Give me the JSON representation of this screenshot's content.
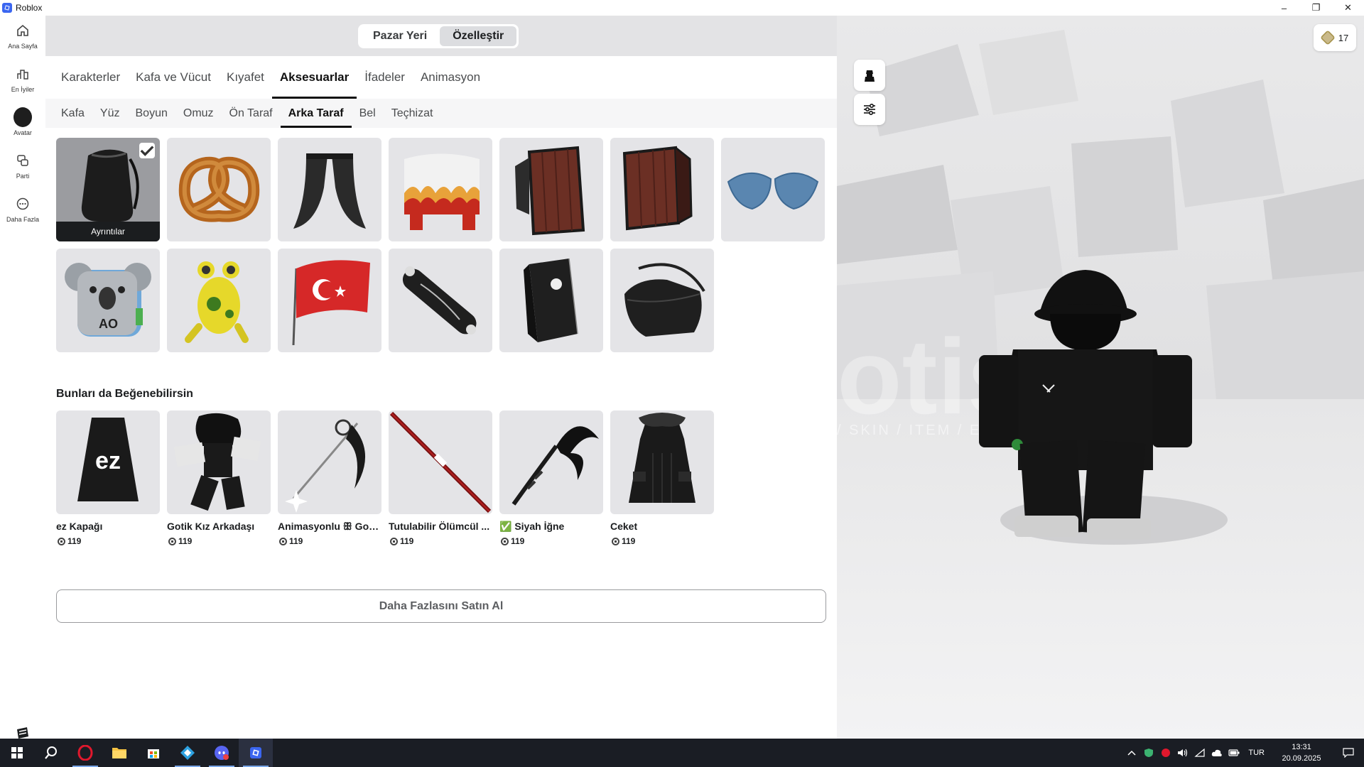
{
  "window": {
    "title": "Roblox"
  },
  "sidebar": [
    {
      "label": "Ana Sayfa"
    },
    {
      "label": "En İyiler"
    },
    {
      "label": "Avatar"
    },
    {
      "label": "Parti"
    },
    {
      "label": "Daha Fazla"
    }
  ],
  "segment": [
    {
      "label": "Pazar Yeri"
    },
    {
      "label": "Özelleştir"
    }
  ],
  "main_tabs": [
    "Karakterler",
    "Kafa ve Vücut",
    "Kıyafet",
    "Aksesuarlar",
    "İfadeler",
    "Animasyon"
  ],
  "main_tab_active": "Aksesuarlar",
  "sub_tabs": [
    "Kafa",
    "Yüz",
    "Boyun",
    "Omuz",
    "Ön Taraf",
    "Arka Taraf",
    "Bel",
    "Teçhizat"
  ],
  "sub_tab_active": "Arka Taraf",
  "inventory": {
    "selected_details_label": "Ayrıntılar",
    "items": [
      {
        "icon": "black-sack-backpack",
        "equipped": true
      },
      {
        "icon": "pretzel"
      },
      {
        "icon": "black-cape"
      },
      {
        "icon": "flame-scarf"
      },
      {
        "icon": "wooden-crate-open"
      },
      {
        "icon": "wooden-crate"
      },
      {
        "icon": "blue-wings"
      },
      {
        "icon": "koala-backpack"
      },
      {
        "icon": "yellow-frog"
      },
      {
        "icon": "turkey-flag"
      },
      {
        "icon": "skateboard"
      },
      {
        "icon": "black-backpack"
      },
      {
        "icon": "black-duffel-bag"
      }
    ]
  },
  "recommendations": {
    "title": "Bunları da Beğenebilirsin",
    "items": [
      {
        "name": "ez Kapağı",
        "price": "119",
        "icon": "ez-cap",
        "thumb_text": "ez"
      },
      {
        "name": "Gotik Kız Arkadaşı",
        "price": "119",
        "icon": "goth-girlfriend"
      },
      {
        "name": "Animasyonlu ꕥ Goti...",
        "price": "119",
        "icon": "animated-scythe"
      },
      {
        "name": "Tutulabilir Ölümcül ...",
        "price": "119",
        "icon": "red-staff"
      },
      {
        "name": "✅ Siyah İğne",
        "price": "119",
        "icon": "black-scythe"
      },
      {
        "name": "Ceket",
        "price": "119",
        "icon": "black-coat"
      }
    ]
  },
  "buy_more_label": "Daha Fazlasını Satın Al",
  "robux_balance": "17",
  "viewport": {
    "watermark": "otis",
    "watermark_sub": "/ SKIN / ITEM / E-PIN.com"
  },
  "taskbar": {
    "apps": [
      "windows-start-icon",
      "search-icon",
      "opera-icon",
      "file-explorer-icon",
      "store-icon",
      "settings-app-icon",
      "discord-icon",
      "roblox-icon"
    ],
    "lang": "TUR",
    "time": "13:31",
    "date": "20.09.2025"
  },
  "colors": {
    "accent_blue": "#3b66f0",
    "taskbar": "#1a1d24",
    "panel_gray": "#e3e3e5",
    "tile": "#e4e4e7"
  }
}
